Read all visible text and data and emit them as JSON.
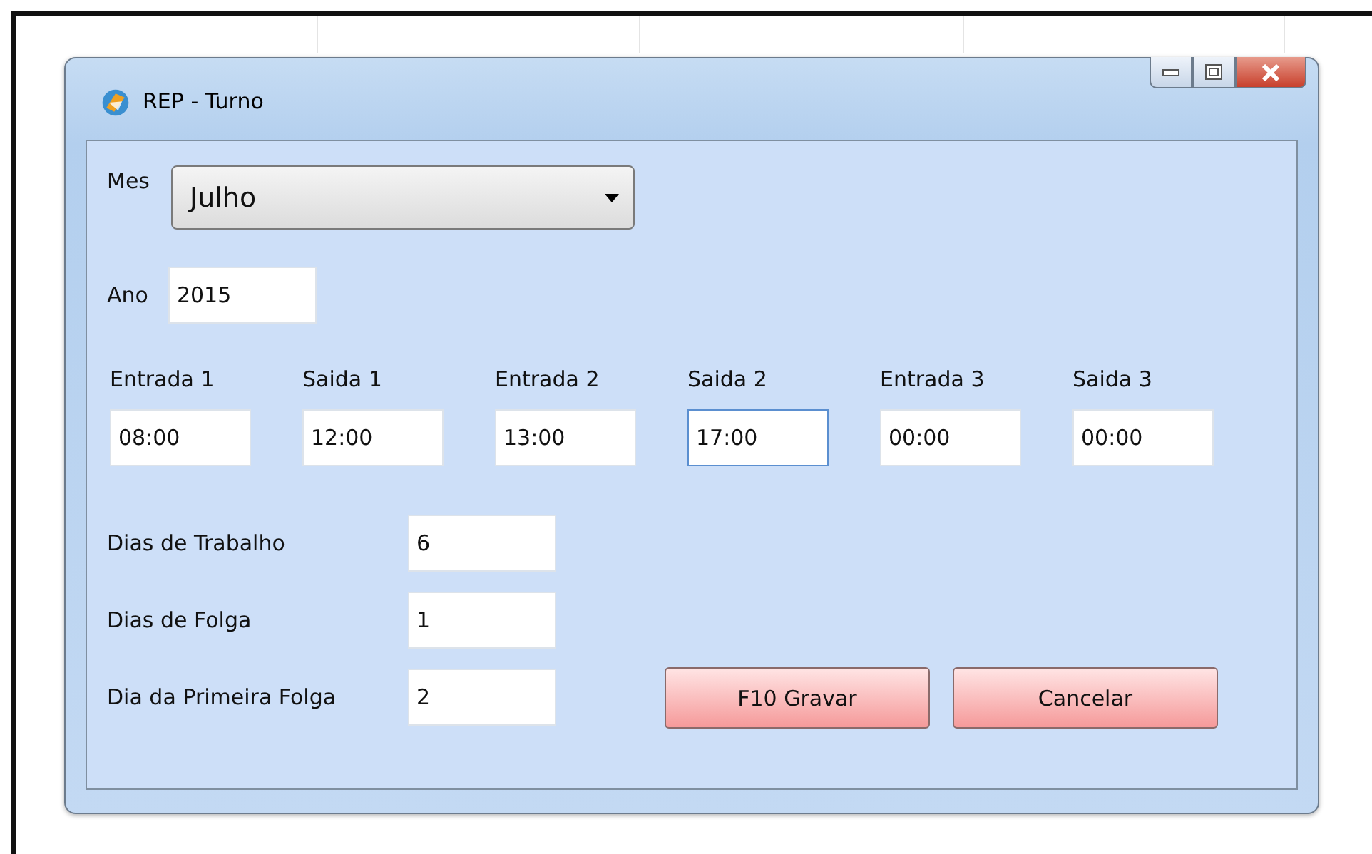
{
  "window": {
    "title": "REP - Turno"
  },
  "month": {
    "label": "Mes",
    "value": "Julho"
  },
  "year": {
    "label": "Ano",
    "value": "2015"
  },
  "times": [
    {
      "label": "Entrada 1",
      "value": "08:00",
      "focused": false
    },
    {
      "label": "Saida 1",
      "value": "12:00",
      "focused": false
    },
    {
      "label": "Entrada 2",
      "value": "13:00",
      "focused": false
    },
    {
      "label": "Saida 2",
      "value": "17:00",
      "focused": true
    },
    {
      "label": "Entrada 3",
      "value": "00:00",
      "focused": false
    },
    {
      "label": "Saida 3",
      "value": "00:00",
      "focused": false
    }
  ],
  "days": [
    {
      "label": "Dias de Trabalho",
      "value": "6"
    },
    {
      "label": "Dias de Folga",
      "value": "1"
    },
    {
      "label": "Dia da Primeira Folga",
      "value": "2"
    }
  ],
  "buttons": [
    "F10 Gravar",
    "Cancelar"
  ]
}
